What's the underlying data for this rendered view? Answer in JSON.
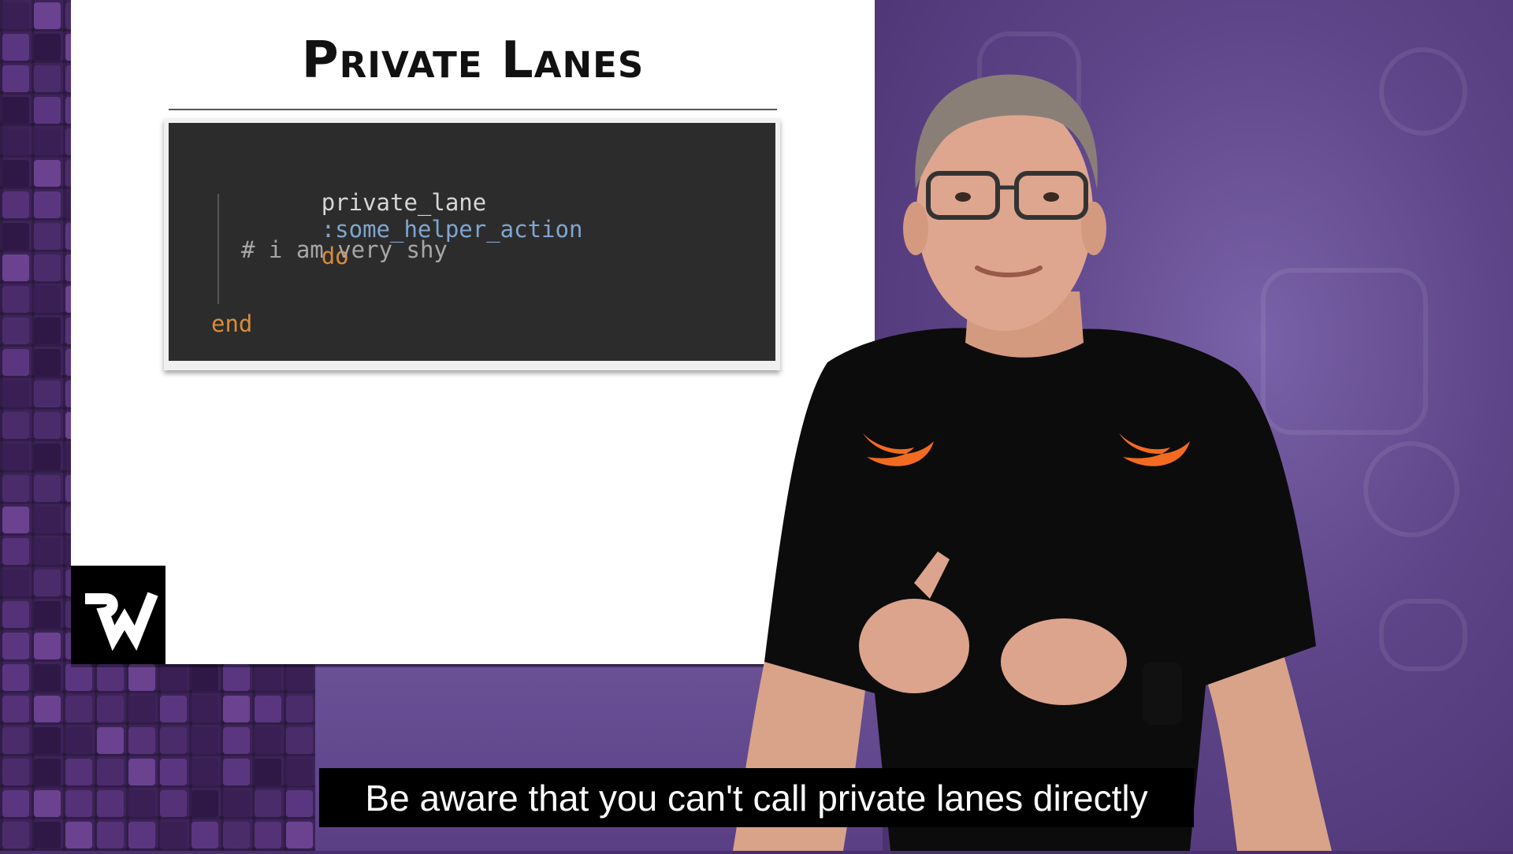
{
  "slide": {
    "title": "Private Lanes",
    "code": {
      "line1_keyword": "private_lane",
      "line1_symbol": ":some_helper_action",
      "line1_do": "do",
      "line2_comment": "# i am very shy",
      "line3_end": "end"
    }
  },
  "subtitle": "Be aware that you can't call private lanes directly",
  "colors": {
    "background_purple": "#4a2f6e",
    "code_background": "#2c2c2c",
    "symbol_blue": "#7fa6cf",
    "keyword_orange": "#d98c3a",
    "shirt_logo_orange": "#f36b21"
  },
  "icons": [
    "raywenderlich-logo-icon",
    "swift-bird-icon"
  ]
}
